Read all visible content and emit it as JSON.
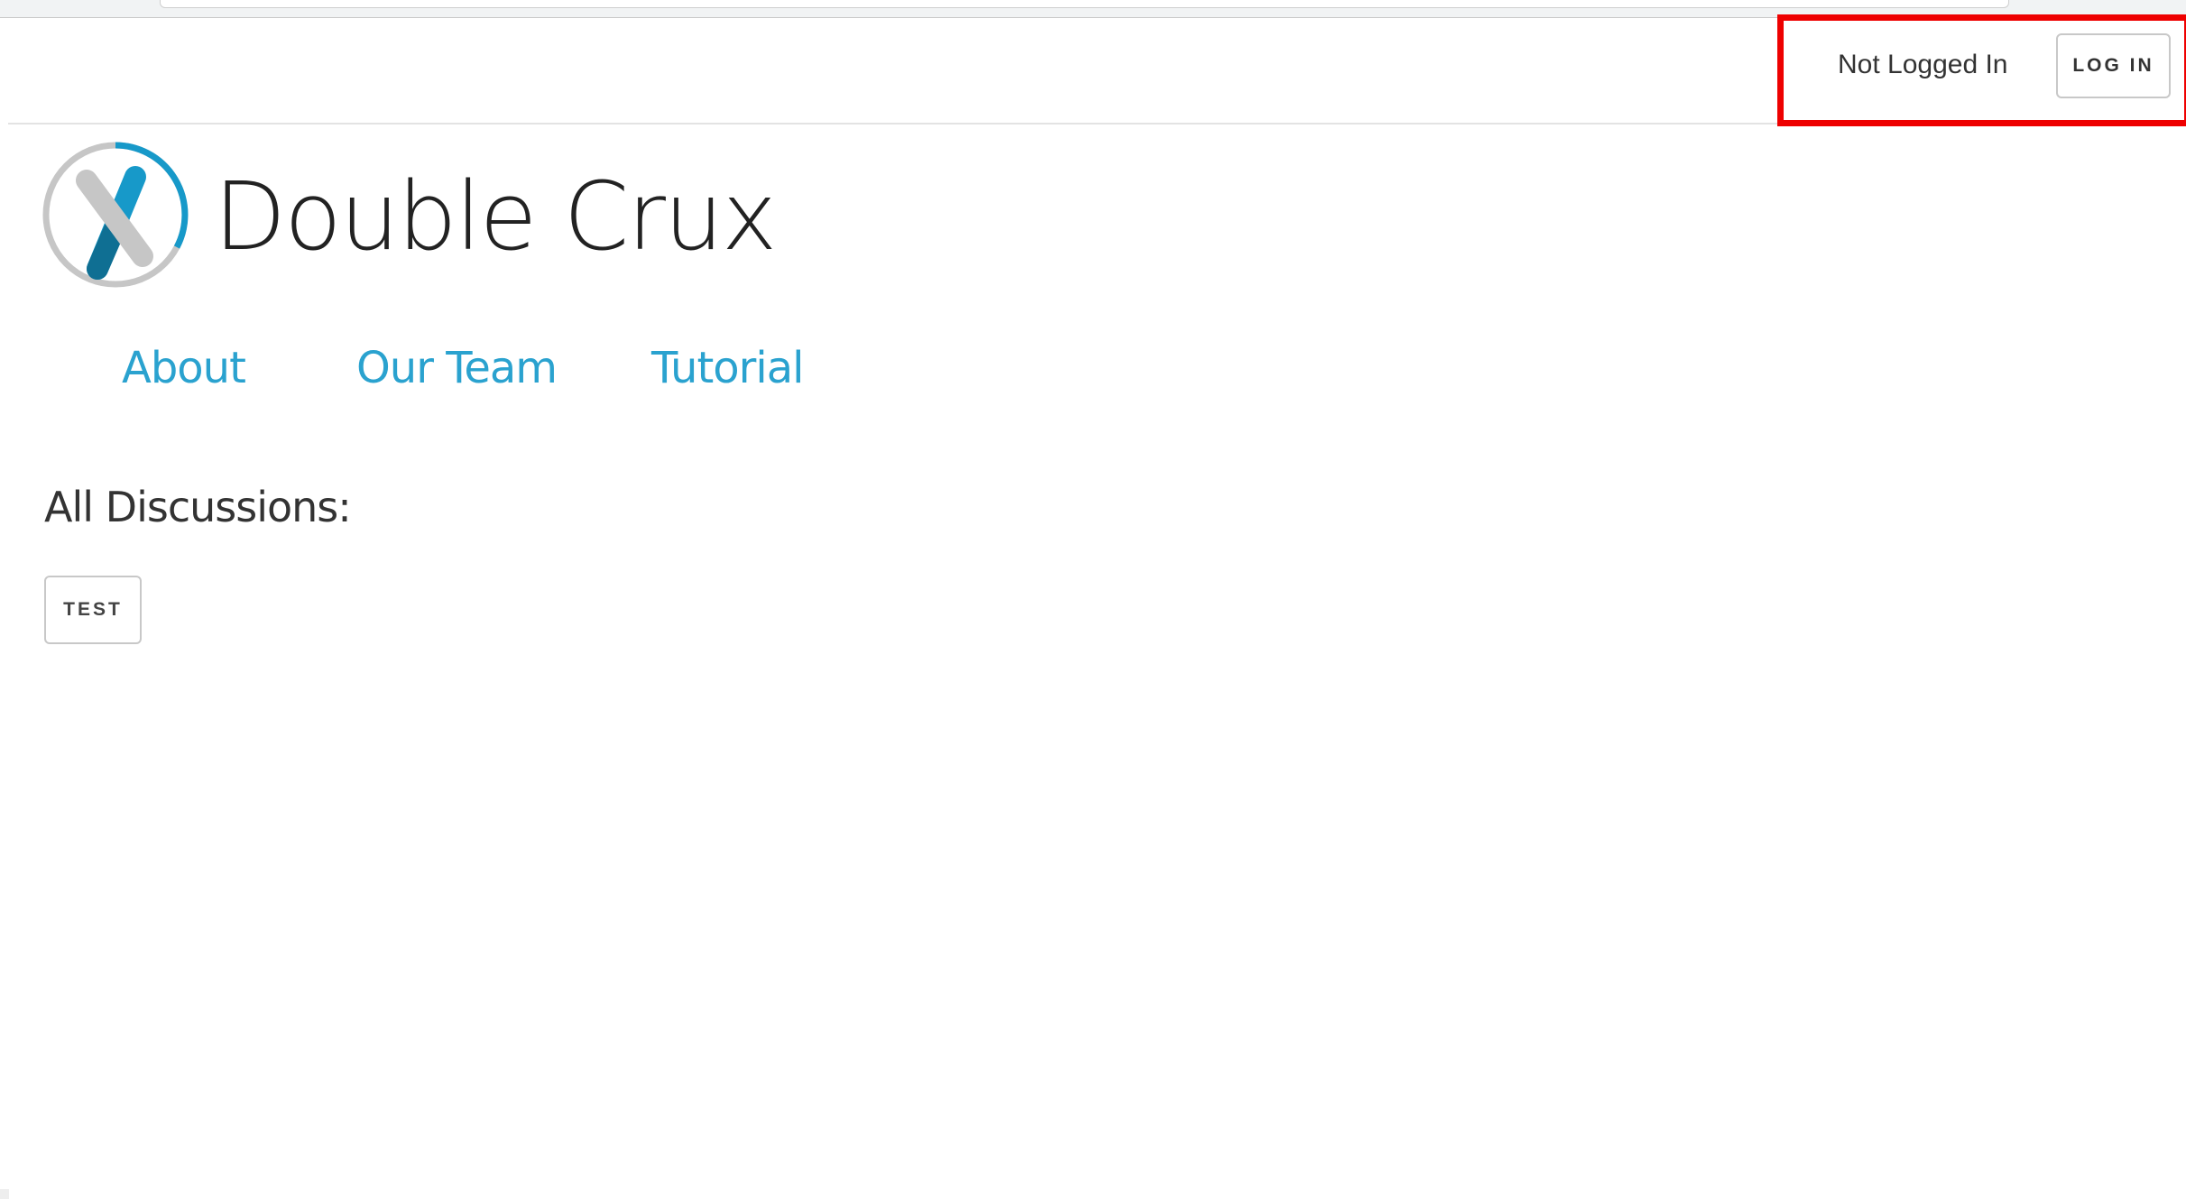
{
  "header": {
    "login_status": "Not Logged In",
    "login_label": "LOG IN"
  },
  "brand": {
    "title": "Double Crux",
    "logo_icon": "double-crux-logo-icon",
    "colors": {
      "accent": "#2aa2cf",
      "logo_blue": "#1799c9",
      "logo_dark_blue": "#0f6f93",
      "logo_gray": "#c6c6c6"
    }
  },
  "nav": {
    "items": [
      {
        "label": "About"
      },
      {
        "label": "Our Team"
      },
      {
        "label": "Tutorial"
      }
    ]
  },
  "discussions": {
    "heading": "All Discussions:",
    "items": [
      {
        "label": "TEST"
      }
    ]
  },
  "annotation": {
    "highlight_color": "#ee0000"
  }
}
